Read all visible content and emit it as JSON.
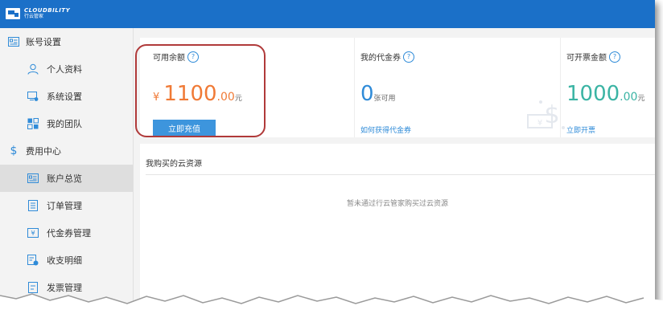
{
  "brand": {
    "name_en": "CLOUDBILITY",
    "name_cn": "行云管家"
  },
  "sidebar": {
    "items": [
      {
        "label": "账号设置",
        "icon": "id-card-icon",
        "level": "group"
      },
      {
        "label": "个人资料",
        "icon": "user-icon",
        "level": "sub"
      },
      {
        "label": "系统设置",
        "icon": "monitor-settings-icon",
        "level": "sub"
      },
      {
        "label": "我的团队",
        "icon": "grid-icon",
        "level": "sub"
      },
      {
        "label": "费用中心",
        "icon": "dollar-icon",
        "level": "group"
      },
      {
        "label": "账户总览",
        "icon": "id-card-icon",
        "level": "sub",
        "active": true
      },
      {
        "label": "订单管理",
        "icon": "document-icon",
        "level": "sub"
      },
      {
        "label": "代金券管理",
        "icon": "voucher-icon",
        "level": "sub"
      },
      {
        "label": "收支明细",
        "icon": "receipt-icon",
        "level": "sub"
      },
      {
        "label": "发票管理",
        "icon": "invoice-icon",
        "level": "sub"
      }
    ]
  },
  "balance": {
    "title": "可用余额",
    "currency": "¥",
    "amount_int": "1100",
    "amount_dec": ".00",
    "unit": "元",
    "button_label": "立即充值"
  },
  "voucher": {
    "title": "我的代金券",
    "count": "0",
    "unit": "张可用",
    "link": "如何获得代金券"
  },
  "invoice": {
    "title": "可开票金额",
    "amount_int": "1000",
    "amount_dec": ".00",
    "unit": "元",
    "link": "立即开票"
  },
  "resources": {
    "title": "我购买的云资源",
    "empty_text": "暂未通过行云管家购买过云资源"
  },
  "colors": {
    "header": "#1b70c8",
    "accent_orange": "#f07a36",
    "accent_blue": "#2f8bd8",
    "accent_teal": "#3bb4a4",
    "highlight_outline": "#b03a3a"
  }
}
